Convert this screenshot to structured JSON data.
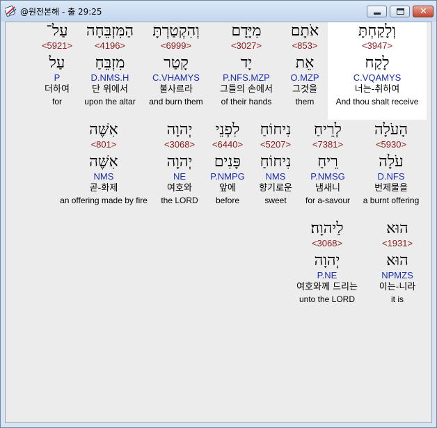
{
  "window": {
    "title": "@원전본해 - 출 29:25"
  },
  "rows": [
    {
      "words": [
        {
          "hebrew": "וְלָקַחְתָּ",
          "strong": "<3947>",
          "lemma": "לָקַח",
          "morph": "C.VQAMYS",
          "korean": "너는-취하여",
          "english": "And thou shalt receive",
          "highlight": true
        },
        {
          "hebrew": "אֹתָם",
          "strong": "<853>",
          "lemma": "אֵת",
          "morph": "O.MZP",
          "korean": "그것을",
          "english": "them"
        },
        {
          "hebrew": "מִיָּדָם",
          "strong": "<3027>",
          "lemma": "יָד",
          "morph": "P.NFS.MZP",
          "korean": "그들의 손에서",
          "english": "of their hands"
        },
        {
          "hebrew": "וְהִקְטַרְתָּ",
          "strong": "<6999>",
          "lemma": "קָטַר",
          "morph": "C.VHAMYS",
          "korean": "불사르라",
          "english": "and burn them"
        },
        {
          "hebrew": "הַמִּזְבֵּחָה",
          "strong": "<4196>",
          "lemma": "מִזְבֵּחַ",
          "morph": "D.NMS.H",
          "korean": "단 위에서",
          "english": "upon the altar"
        },
        {
          "hebrew": "עַל־",
          "strong": "<5921>",
          "lemma": "עַל",
          "morph": "P",
          "korean": "더하여",
          "english": "for"
        }
      ]
    },
    {
      "words": [
        {
          "hebrew": "הָעֹלָה",
          "strong": "<5930>",
          "lemma": "עֹלָה",
          "morph": "D.NFS",
          "korean": "번제물을",
          "english": "a burnt offering"
        },
        {
          "hebrew": "לְרֵיחַ",
          "strong": "<7381>",
          "lemma": "רֵיחַ",
          "morph": "P.NMSG",
          "korean": "냄새니",
          "english": "for a-savour"
        },
        {
          "hebrew": "נִיחוֹחַ",
          "strong": "<5207>",
          "lemma": "נִיחוֹחַ",
          "morph": "NMS",
          "korean": "향기로운",
          "english": "sweet"
        },
        {
          "hebrew": "לִפְנֵי",
          "strong": "<6440>",
          "lemma": "פָּנִים",
          "morph": "P.NMPG",
          "korean": "앞에",
          "english": "before"
        },
        {
          "hebrew": "יְהוָה",
          "strong": "<3068>",
          "lemma": "יְהוָה",
          "morph": "NE",
          "korean": "여호와",
          "english": "the LORD"
        },
        {
          "hebrew": "אִשֶּׁה",
          "strong": "<801>",
          "lemma": "אִשֶּׁה",
          "morph": "NMS",
          "korean": "곧-화제",
          "english": "an offering made by fire"
        }
      ]
    },
    {
      "words": [
        {
          "hebrew": "הוּא",
          "strong": "<1931>",
          "lemma": "הוּא",
          "morph": "NPMZS",
          "korean": "이는-니라",
          "english": "it is"
        },
        {
          "hebrew": "לַיהוָה׃",
          "strong": "<3068>",
          "lemma": "יְהוָה",
          "morph": "P.NE",
          "korean": "여호와께 드리는",
          "english": "unto the LORD"
        }
      ]
    }
  ]
}
